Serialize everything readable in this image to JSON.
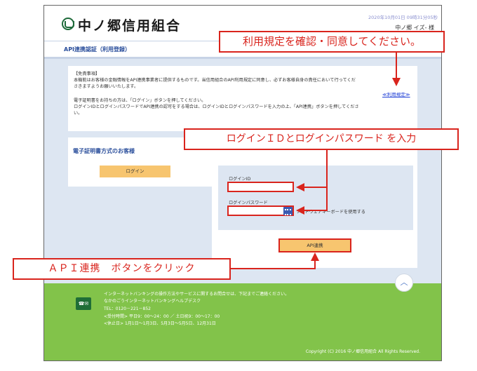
{
  "header": {
    "logo_text": "中ノ郷信用組合",
    "datetime": "2020年10月01日 09時31分05秒",
    "user": "中ノ郷 イズ-  様"
  },
  "page": {
    "subtitle": "API連携認証（利用登録）"
  },
  "notice": {
    "heading": "【免責事項】",
    "line1": "本機能はお客様の金融情報をAPI連携事業者に提供するものです。当信用組合のAPI利用規定に同意し、必ずお客様自身の責任において行ってくだ",
    "line2": "さきますようお願いいたします。",
    "line3": "電子証明書をお持ちの方は、「ログイン」ボタンを押してください。",
    "line4": "ログインIDとログインパスワードでAPI連携の認可をする場合は、ログインIDとログインパスワードを入力の上、「API連携」ボタンを押してくださ",
    "line5": "い。",
    "terms_link": "≪利用規定≫"
  },
  "cert": {
    "title": "電子証明書方式のお客様",
    "login_label": "ログイン"
  },
  "login_form": {
    "id_label": "ログインID",
    "password_label": "ログインパスワード",
    "soft_keyboard_label": "ソフトウェアキーボードを使用する",
    "api_button_label": "API連携"
  },
  "footer": {
    "line1": "インターネットバンキングの操作方法やサービスに関するお問合せは、下記までご連絡ください。",
    "line2": "なかのごうインターネットバンキングヘルプデスク",
    "line3": "TEL：0120－221－852",
    "line4": "<受付時間> 平日9：00～24：00 ／ 土日祝9：00～17：00",
    "line5": "<休止日> 1月1日～1月3日、5月3日～5月5日、12月31日",
    "copyright": "Copyright (C) 2016 中ノ郷信用組合 All Rights Reserved."
  },
  "annotations": {
    "terms": "利用規定を確認・同意してください。",
    "login": "ログインＩＤとログインパスワード を入力",
    "api": "ＡＰＩ連携　ボタンをクリック"
  },
  "colors": {
    "accent_red": "#d9241d",
    "button_orange": "#f7c56f",
    "footer_green": "#82c34a",
    "title_blue": "#2b4f9c"
  },
  "icons": [
    "logo-icon",
    "keyboard-icon",
    "chevron-up-icon",
    "contact-icon"
  ]
}
